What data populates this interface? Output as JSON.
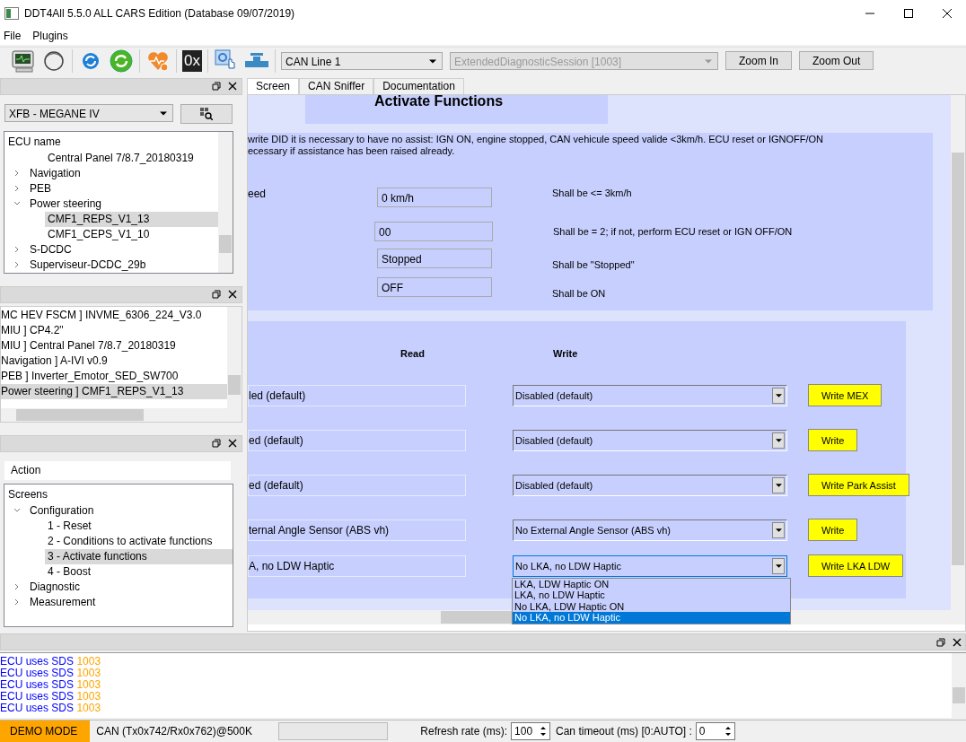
{
  "window": {
    "title": "DDT4All 5.5.0 ALL CARS Edition (Database 09/07/2019)"
  },
  "menu": [
    "File",
    "Plugins"
  ],
  "toolbar": {
    "hex_label": "0x",
    "can_line": "CAN Line 1",
    "session": {
      "value": "ExtendedDiagnosticSession [1003]",
      "disabled": true
    },
    "buttons": [
      "Zoom In",
      "Zoom Out"
    ]
  },
  "ecu_panel": {
    "vehicle": "XFB - MEGANE IV",
    "tree_header": "ECU name",
    "tree": [
      {
        "label": "Central Panel 7/8.7_20180319",
        "indent": true,
        "selected": false
      },
      {
        "label": "Navigation",
        "expanded": false,
        "selected": false
      },
      {
        "label": "PEB",
        "expanded": false,
        "selected": false
      },
      {
        "label": "Power steering",
        "expanded": true,
        "selected": false,
        "children": [
          {
            "label": "CMF1_REPS_V1_13",
            "selected": true
          },
          {
            "label": "CMF1_CEPS_V1_10",
            "selected": false
          }
        ]
      },
      {
        "label": "S-DCDC",
        "expanded": false,
        "selected": false
      },
      {
        "label": "Superviseur-DCDC_29b",
        "expanded": false,
        "selected": false
      }
    ]
  },
  "ecu_list": [
    {
      "label": "MC HEV FSCM ] INVME_6306_224_V3.0",
      "selected": false
    },
    {
      "label": "MIU ] CP4.2\"",
      "selected": false
    },
    {
      "label": "MIU ] Central Panel 7/8.7_20180319",
      "selected": false
    },
    {
      "label": "Navigation ] A-IVI v0.9",
      "selected": false
    },
    {
      "label": "PEB ] Inverter_Emotor_SED_SW700",
      "selected": false
    },
    {
      "label": "Power steering ] CMF1_REPS_V1_13",
      "selected": true
    }
  ],
  "screens_panel": {
    "header": "Action",
    "tree_header": "Screens",
    "tree": [
      {
        "label": "Configuration",
        "expanded": true,
        "selected": false,
        "children": [
          {
            "label": "1 - Reset",
            "selected": false
          },
          {
            "label": "2 - Conditions to activate functions",
            "selected": false
          },
          {
            "label": "3 - Activate functions",
            "selected": true
          },
          {
            "label": "4 - Boost",
            "selected": false
          }
        ]
      },
      {
        "label": "Diagnostic",
        "expanded": false,
        "selected": false
      },
      {
        "label": "Measurement",
        "expanded": false,
        "selected": false
      }
    ]
  },
  "tabs": [
    {
      "label": "Screen",
      "selected": true
    },
    {
      "label": "CAN Sniffer",
      "selected": false
    },
    {
      "label": "Documentation",
      "selected": false
    }
  ],
  "screen": {
    "title": "Activate Functions",
    "note": [
      "write DID it is necessary to have no assist: IGN ON, engine stopped, CAN vehicule speed valide <3km/h. ECU reset or IGNOFF/ON",
      "ecessary if assistance has been raised already."
    ],
    "conditions": [
      {
        "label": "eed",
        "value": "0 km/h",
        "hint": "Shall be <= 3km/h"
      },
      {
        "value": "00",
        "hint": "Shall be = 2; if not, perform ECU reset or IGN OFF/ON"
      },
      {
        "value": "Stopped",
        "hint": "Shall be \"Stopped\""
      },
      {
        "value": "OFF",
        "hint": "Shall be ON"
      }
    ],
    "columns": [
      "Read",
      "Write"
    ],
    "functions": [
      {
        "read": "led (default)",
        "write": "Disabled (default)",
        "button": "Write MEX",
        "open": false
      },
      {
        "read": "ed (default)",
        "write": "Disabled (default)",
        "button": "Write",
        "open": false
      },
      {
        "read": "ed (default)",
        "write": "Disabled (default)",
        "button": "Write Park Assist",
        "open": false
      },
      {
        "read": "ternal Angle Sensor (ABS vh)",
        "write": "No External Angle Sensor (ABS vh)",
        "button": "Write",
        "open": false
      },
      {
        "read": "A, no LDW Haptic",
        "write": "No LKA, no LDW Haptic",
        "button": "Write LKA LDW",
        "open": true
      }
    ],
    "dropdown": [
      {
        "label": "LKA, LDW Haptic ON",
        "selected": false
      },
      {
        "label": "LKA, no LDW Haptic",
        "selected": false
      },
      {
        "label": "No LKA, LDW Haptic ON",
        "selected": false
      },
      {
        "label": "No LKA, no LDW Haptic",
        "selected": true
      }
    ]
  },
  "log": [
    {
      "text": "ECU uses SDS",
      "code": "1003"
    },
    {
      "text": "ECU uses SDS",
      "code": "1003"
    },
    {
      "text": "ECU uses SDS",
      "code": "1003"
    },
    {
      "text": "ECU uses SDS",
      "code": "1003"
    },
    {
      "text": "ECU uses SDS",
      "code": "1003"
    }
  ],
  "status_bar": {
    "mode": "DEMO MODE",
    "connection": "CAN (Tx0x742/Rx0x762)@500K",
    "refresh_label": "Refresh rate (ms):",
    "refresh_value": "100",
    "timeout_label": "Can timeout (ms) [0:AUTO] :",
    "timeout_value": "0"
  }
}
